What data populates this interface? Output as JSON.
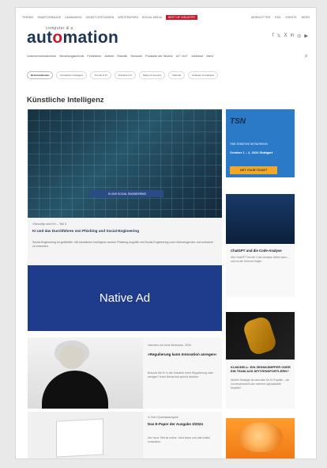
{
  "topbar": {
    "left": [
      "TRENDS",
      "SMARTGEBÄUDE",
      "LAWMAKING",
      "DIENSTLEISTUNGEN",
      "WHITEPAPERS",
      "SOCIAL MEDIA"
    ],
    "highlight": "BEST OF INDUSTRY",
    "right": [
      "NEWSLETTER",
      "RSS",
      "EVENTS",
      "MEHR"
    ]
  },
  "brand": {
    "top_text": "computer & a",
    "name_prefix": "aut",
    "name_highlight": "o",
    "name_suffix": "mation"
  },
  "social_icons": [
    "f",
    "𝕏",
    "X",
    "in",
    "◎",
    "▶"
  ],
  "mainnav": [
    "Unternehmenstechnik",
    "Steuerungstechnik",
    "Feldebene",
    "Antrieb",
    "Robotik",
    "Sensorik",
    "Produkte der Woche",
    "IoT / IIoT",
    "Jobbörse",
    "Mehr"
  ],
  "subnav": [
    {
      "label": "KI-Innovationen",
      "active": true
    },
    {
      "label": "Künstliche Intelligenz",
      "active": false
    },
    {
      "label": "Trends & KI",
      "active": false
    },
    {
      "label": "Industrie 4.0",
      "active": false
    },
    {
      "label": "Safety & Security",
      "active": false
    },
    {
      "label": "Robotik",
      "active": false
    },
    {
      "label": "Software & Analytics",
      "active": false
    }
  ],
  "section_title": "Künstliche Intelligenz",
  "feature": {
    "image_text": "KI UND SOCIAL ENGINEERING",
    "meta": "»Security und KI« – Teil 3",
    "headline": "KI und das Durchführen von Phishing und Social-Engineering",
    "body": "Social-Engineering ist gefährlich. Mit künstlicher Intelligenz werden Phishing-Angriffe und Social Engineering noch überzeugender und schwerer zu erkennen."
  },
  "native_ad": "Native Ad",
  "card2": {
    "tag": "Interview mit Irene Bertschek, ZEW",
    "title": "»Regulierung kann Innovation anregen«",
    "text": "Braucht die KI in der Industrie mehr Regulierung oder weniger? Irene Bertschek spricht darüber."
  },
  "card3": {
    "tag": "In Ihrer Quartalsausgabe",
    "title": "Das E-Paper der Ausgabe 3/2024",
    "text": "Der neue Titel ist online. Jetzt lesen und alle Artikel entdecken."
  },
  "tsn": {
    "logo": "TSN",
    "line1": "TIME SENSITIVE NETWORKING",
    "line2": "October 1 – 2, 2024 Stuttgart",
    "cta": "GET YOUR TICKET"
  },
  "rc1": {
    "title": "ChatGPT und die Code-Analyse",
    "text": "Wie ChatGPT bei der Code-Analyse helfen kann – und wo die Grenzen liegen."
  },
  "rc2": {
    "title": "KI-MODELL: EIN ZEHNKÄMPFER ODER EIN TEAM AUS SPITZENSPORTLERN?",
    "text": "Welche Strategie ist sinnvoller für KI-Projekte – ein Universalmodell oder mehrere spezialisierte Modelle?"
  }
}
